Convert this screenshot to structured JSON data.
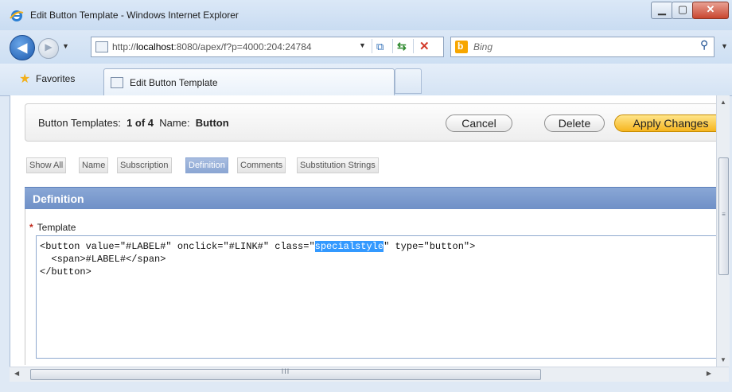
{
  "window": {
    "title": "Edit Button Template - Windows Internet Explorer"
  },
  "address": {
    "url_prefix": "http://",
    "url_host": "localhost",
    "url_rest": ":8080/apex/f?p=4000:204:24784"
  },
  "search": {
    "placeholder": "Bing"
  },
  "favorites": {
    "label": "Favorites"
  },
  "tabs": {
    "active_label": "Edit Button Template"
  },
  "page": {
    "header_prefix": "Button Templates:",
    "header_count": "1 of 4",
    "header_name_label": "Name:",
    "header_name_value": "Button",
    "buttons": {
      "cancel": "Cancel",
      "delete": "Delete",
      "apply": "Apply Changes"
    },
    "subtabs": [
      "Show All",
      "Name",
      "Subscription",
      "Definition",
      "Comments",
      "Substitution Strings"
    ],
    "active_subtab": "Definition",
    "region_title": "Definition",
    "field_label": "Template",
    "code": {
      "line1_before": "<button value=\"#LABEL#\" onclick=\"#LINK#\" class=\"",
      "line1_selected": "specialstyle",
      "line1_after": "\" type=\"button\">",
      "line2": "  <span>#LABEL#</span>",
      "line3": "</button>"
    }
  },
  "scrollbar": {
    "grip": "III"
  },
  "colors": {
    "region_header": "#7895cb",
    "apply_button": "#f6b51f",
    "selection": "#3399ff",
    "required": "#c0281a"
  }
}
